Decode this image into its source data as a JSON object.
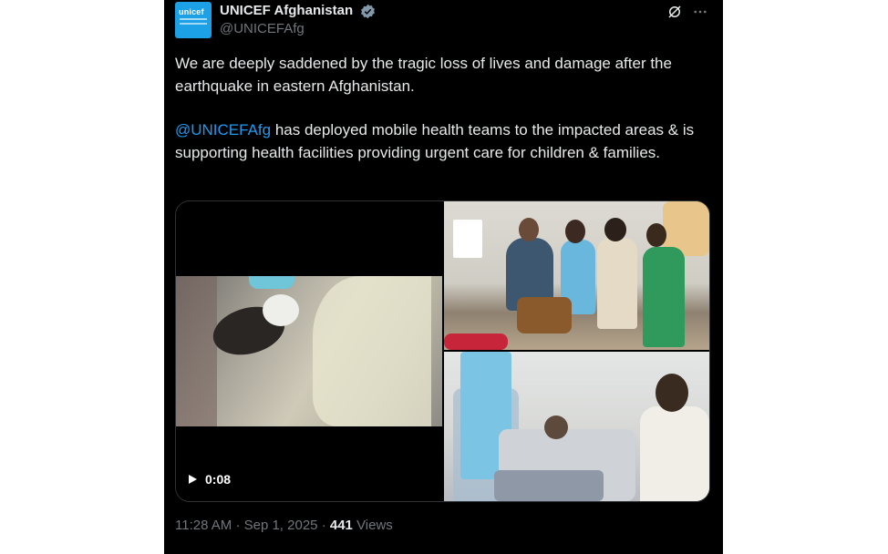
{
  "tweet": {
    "avatar_text": "unicef",
    "display_name": "UNICEF Afghanistan",
    "handle": "@UNICEFAfg",
    "paragraph_1": "We are deeply saddened by the tragic loss of lives and damage after the earthquake in eastern Afghanistan.",
    "mention": "@UNICEFAfg",
    "paragraph_2_rest": " has deployed mobile health teams to the impacted areas & is supporting health facilities  providing urgent care for children & families.",
    "video_duration": "0:08",
    "time": "11:28 AM",
    "date": "Sep 1, 2025",
    "views_count": "441",
    "views_label": "Views"
  },
  "icons": {
    "verified": "verified-badge-icon",
    "grok": "grok-icon",
    "more": "more-options-icon",
    "play": "play-icon"
  },
  "colors": {
    "background": "#000000",
    "text": "#e7e9ea",
    "secondary": "#71767b",
    "link": "#1d9bf0",
    "avatar": "#1ca0e6"
  }
}
